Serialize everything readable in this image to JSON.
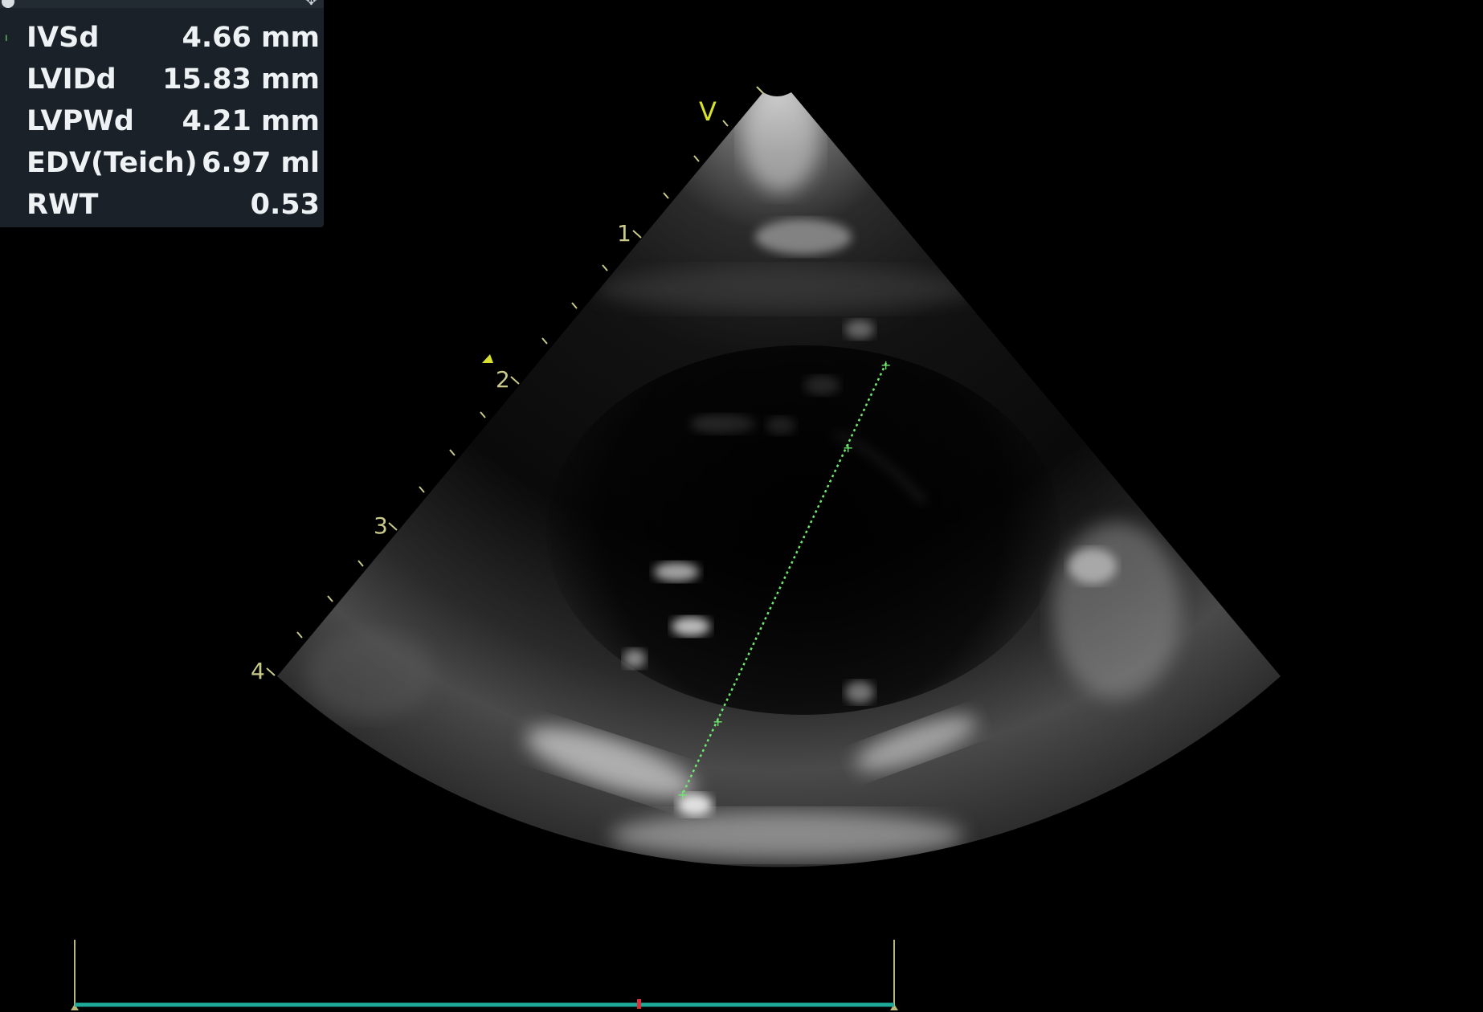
{
  "orientation_marker": "V",
  "depth_scale": {
    "labels": [
      "1",
      "2",
      "3",
      "4"
    ]
  },
  "measurements": [
    {
      "label": "IVSd",
      "value": "4.66 mm"
    },
    {
      "label": "LVIDd",
      "value": "15.83 mm"
    },
    {
      "label": "LVPWd",
      "value": "4.21 mm"
    },
    {
      "label": "EDV(Teich)",
      "value": "6.97 ml"
    },
    {
      "label": "RWT",
      "value": "0.53"
    }
  ],
  "caliper": {
    "color": "#6fe86f"
  },
  "timeline": {
    "bar_color": "#1fa99a",
    "marker_color": "#d9303a",
    "bound_color": "#b8b87a"
  },
  "panel": {
    "background": "#1a2128",
    "text_color": "#eef2f4"
  }
}
